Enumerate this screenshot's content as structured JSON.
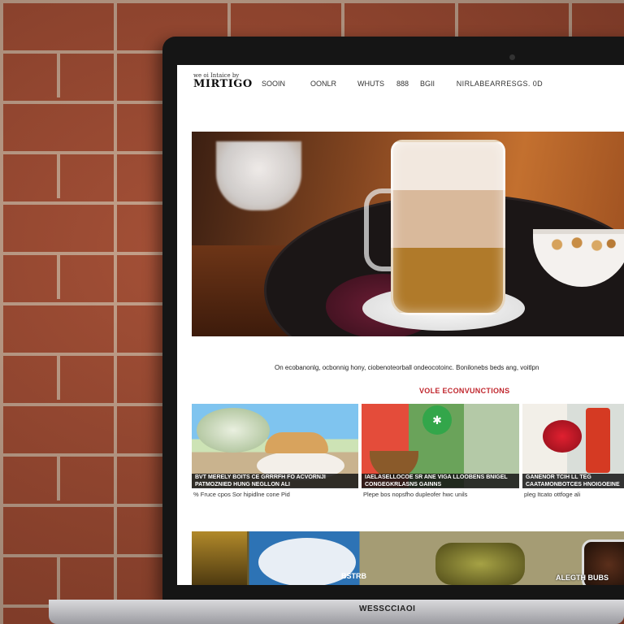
{
  "nav": {
    "logo_small": "we oi Intaice by",
    "logo_big": "MIRTIGO",
    "items": [
      "SOOIN",
      "OONLR",
      "WHUTS",
      "888",
      "BGII"
    ],
    "contact": "NIRLABEARRESGS. 0D"
  },
  "hero": {
    "tagline": "On ecobanonlg, ocbonnig hony, ciobenoteorball ondeocotoinc. Bonilonebs beds ang, voitlpn",
    "section_title": "VOLE ECONVUNCTIONS"
  },
  "cards": [
    {
      "caption": "BVT MERELY BOITS CE GRRRFH FO ACVORNJI PATMOZNIED HUNG NEGLLON ALI",
      "sub": "% Fruce cpos Sor hipidlne cone Pid"
    },
    {
      "caption": "IAELASELLOCOE SR ANE VIGA LLOOBENS BNIGEL CONGEGKRLASNS GAINNS",
      "sub": "Plepe bos nopsfho dupleofer hwc unils"
    },
    {
      "caption": "GANENOR TCIH LL TEG CAATAMONBOTCES HNOIGOEINE",
      "sub": "pleg Itcato ottfoge ali"
    }
  ],
  "bottom": {
    "label_a": "BSTRB",
    "label_b": "ALEGTH BUBS"
  },
  "laptop": {
    "brand": "WESSCCIAOI"
  },
  "icons": {
    "badge": "leaf-badge-icon"
  }
}
